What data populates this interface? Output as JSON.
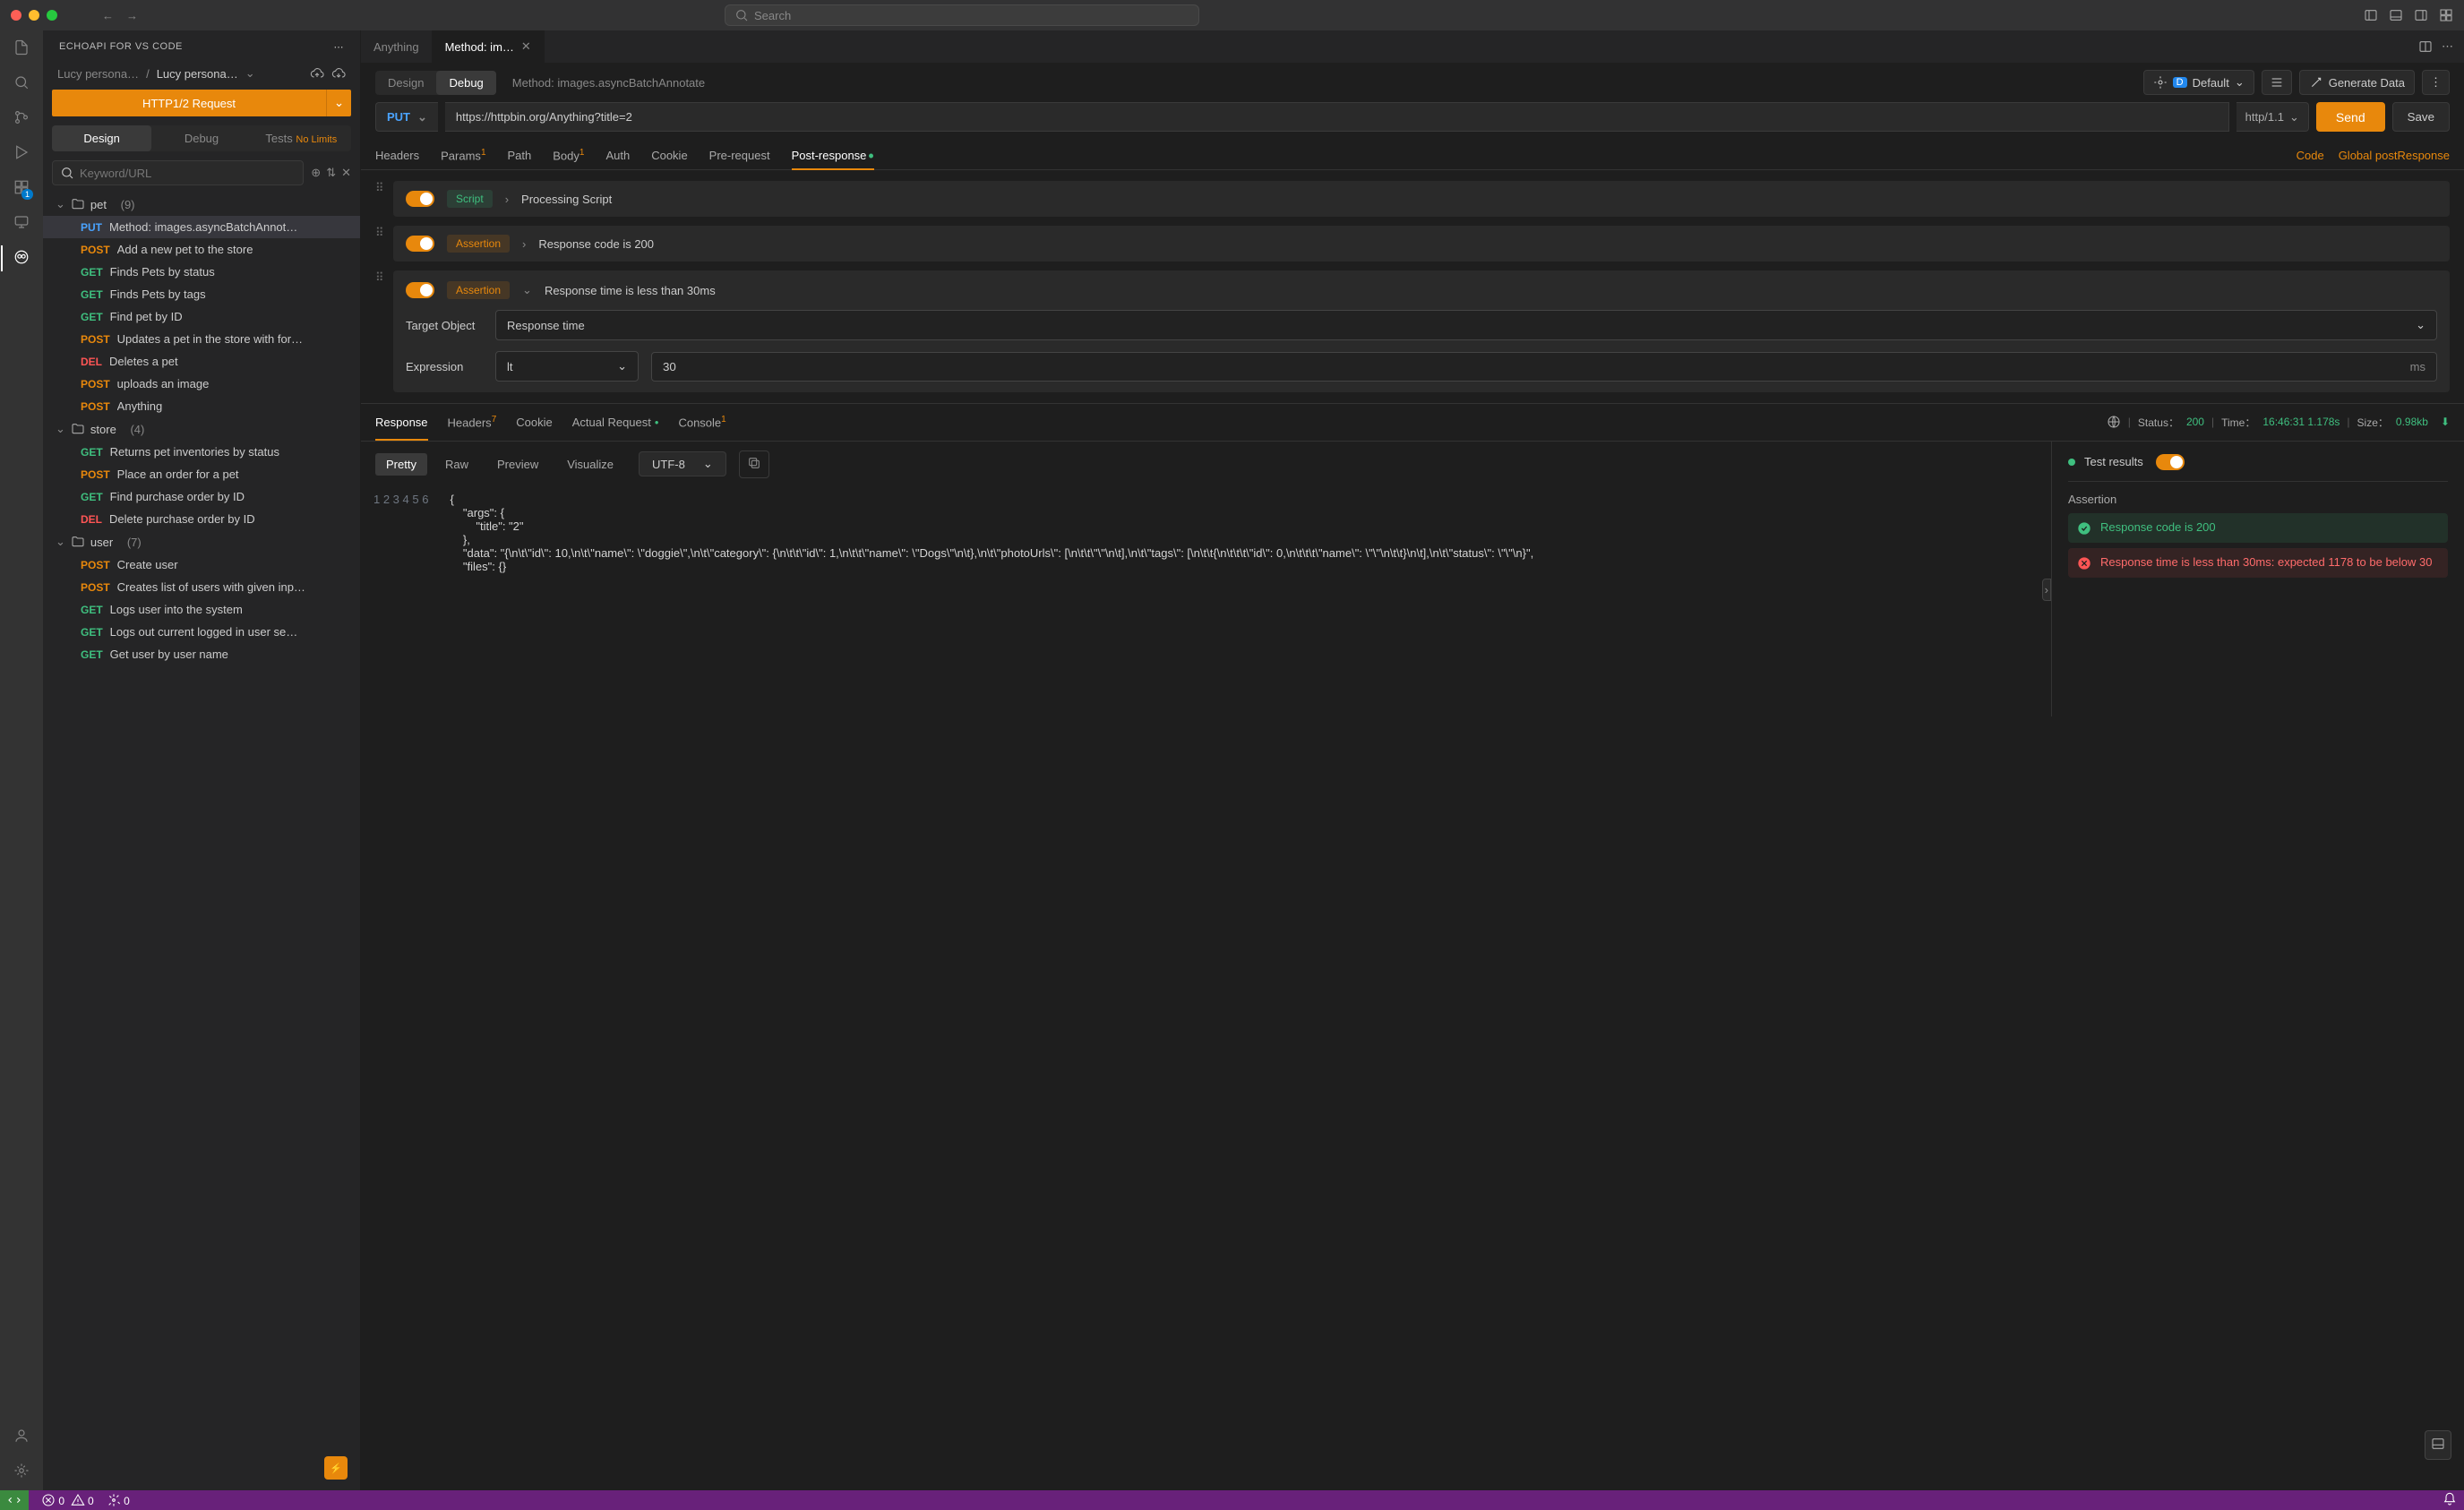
{
  "titlebar": {
    "search_placeholder": "Search"
  },
  "sidebar": {
    "extension_title": "ECHOAPI FOR VS CODE",
    "breadcrumb": {
      "a": "Lucy persona…",
      "b": "Lucy persona…"
    },
    "http_request_btn": "HTTP1/2 Request",
    "tabs": {
      "design": "Design",
      "debug": "Debug",
      "tests": "Tests",
      "tests_badge": "No Limits"
    },
    "filter_placeholder": "Keyword/URL",
    "tree": {
      "pet": {
        "name": "pet",
        "count": "(9)",
        "items": [
          {
            "method": "PUT",
            "label": "Method: images.asyncBatchAnnot…"
          },
          {
            "method": "POST",
            "label": "Add a new pet to the store"
          },
          {
            "method": "GET",
            "label": "Finds Pets by status"
          },
          {
            "method": "GET",
            "label": "Finds Pets by tags"
          },
          {
            "method": "GET",
            "label": "Find pet by ID"
          },
          {
            "method": "POST",
            "label": "Updates a pet in the store with for…"
          },
          {
            "method": "DEL",
            "label": "Deletes a pet"
          },
          {
            "method": "POST",
            "label": "uploads an image"
          },
          {
            "method": "POST",
            "label": "Anything"
          }
        ]
      },
      "store": {
        "name": "store",
        "count": "(4)",
        "items": [
          {
            "method": "GET",
            "label": "Returns pet inventories by status"
          },
          {
            "method": "POST",
            "label": "Place an order for a pet"
          },
          {
            "method": "GET",
            "label": "Find purchase order by ID"
          },
          {
            "method": "DEL",
            "label": "Delete purchase order by ID"
          }
        ]
      },
      "user": {
        "name": "user",
        "count": "(7)",
        "items": [
          {
            "method": "POST",
            "label": "Create user"
          },
          {
            "method": "POST",
            "label": "Creates list of users with given inp…"
          },
          {
            "method": "GET",
            "label": "Logs user into the system"
          },
          {
            "method": "GET",
            "label": "Logs out current logged in user se…"
          },
          {
            "method": "GET",
            "label": "Get user by user name"
          }
        ]
      }
    }
  },
  "editor": {
    "tabs": {
      "anything": "Anything",
      "method_im": "Method: im…"
    },
    "mode": {
      "design": "Design",
      "debug": "Debug"
    },
    "method_title": "Method: images.asyncBatchAnnotate",
    "env": {
      "label": "Default"
    },
    "generate_data": "Generate Data",
    "url_row": {
      "method": "PUT",
      "url": "https://httpbin.org/Anything?title=2",
      "protocol": "http/1.1",
      "send": "Send",
      "save": "Save"
    },
    "request_tabs": {
      "headers": "Headers",
      "params": "Params",
      "path": "Path",
      "body": "Body",
      "auth": "Auth",
      "cookie": "Cookie",
      "pre_request": "Pre-request",
      "post_response": "Post-response",
      "code": "Code",
      "global_post": "Global postResponse"
    },
    "processors": {
      "script": {
        "tag": "Script",
        "text": "Processing Script"
      },
      "assertion1": {
        "tag": "Assertion",
        "text": "Response code is 200"
      },
      "assertion2": {
        "tag": "Assertion",
        "text": "Response time is less than 30ms",
        "target_label": "Target Object",
        "target_value": "Response time",
        "expression_label": "Expression",
        "operator": "lt",
        "value": "30",
        "unit": "ms"
      }
    }
  },
  "response": {
    "tabs": {
      "response": "Response",
      "headers": "Headers",
      "headers_count": "7",
      "cookie": "Cookie",
      "actual_request": "Actual Request",
      "console": "Console",
      "console_count": "1"
    },
    "status": {
      "status_label": "Status：",
      "status_value": "200",
      "time_label": "Time：",
      "time_value": "16:46:31 1.178s",
      "size_label": "Size：",
      "size_value": "0.98kb"
    },
    "view_tabs": {
      "pretty": "Pretty",
      "raw": "Raw",
      "preview": "Preview",
      "visualize": "Visualize"
    },
    "encoding": "UTF-8",
    "body_lines": [
      "{",
      "    \"args\": {",
      "        \"title\": \"2\"",
      "    },",
      "    \"data\": \"{\\n\\t\\\"id\\\": 10,\\n\\t\\\"name\\\": \\\"doggie\\\",\\n\\t\\\"category\\\": {\\n\\t\\t\\\"id\\\": 1,\\n\\t\\t\\\"name\\\": \\\"Dogs\\\"\\n\\t},\\n\\t\\\"photoUrls\\\": [\\n\\t\\t\\\"\\\"\\n\\t],\\n\\t\\\"tags\\\": [\\n\\t\\t{\\n\\t\\t\\t\\\"id\\\": 0,\\n\\t\\t\\t\\\"name\\\": \\\"\\\"\\n\\t\\t}\\n\\t],\\n\\t\\\"status\\\": \\\"\\\"\\n}\",",
      "    \"files\": {}"
    ],
    "test_results": {
      "title": "Test results",
      "assertion_label": "Assertion",
      "pass": "Response code is 200",
      "fail": "Response time is less than 30ms: expected 1178 to be below 30"
    }
  },
  "statusbar": {
    "errors": "0",
    "warnings": "0",
    "ports": "0"
  }
}
